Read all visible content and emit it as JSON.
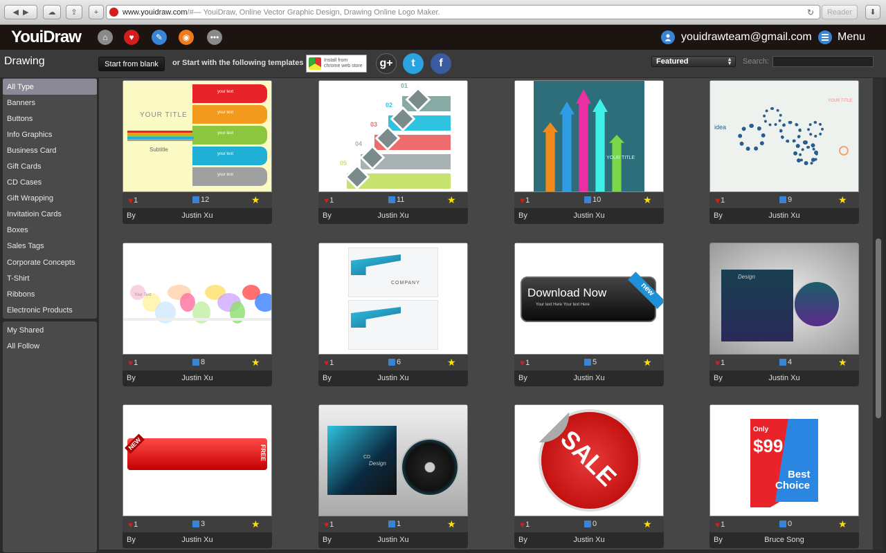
{
  "browser": {
    "url_domain": "www.youidraw.com",
    "url_rest": "/#— YouiDraw, Online Vector Graphic Design, Drawing Online Logo Maker.",
    "reader_label": "Reader"
  },
  "header": {
    "logo": "YouiDraw",
    "user_email": "youidrawteam@gmail.com",
    "menu_label": "Menu"
  },
  "toolbar": {
    "title": "Drawing",
    "start_blank": "Start from blank",
    "template_text": "or Start with the following templates",
    "chrome_store_line1": "Install from",
    "chrome_store_line2": "chrome web store",
    "social_google": "g+",
    "social_twitter": "t",
    "social_facebook": "f",
    "sort_selected": "Featured",
    "search_label": "Search:",
    "search_value": ""
  },
  "sidebar": {
    "categories": [
      "All Type",
      "Banners",
      "Buttons",
      "Info Graphics",
      "Business Card",
      "Gift Cards",
      "CD Cases",
      "Gift Wrapping",
      "Invitatioin Cards",
      "Boxes",
      "Sales Tags",
      "Corporate Concepts",
      "T-Shirt",
      "Ribbons",
      "Electronic Products"
    ],
    "active": "All Type",
    "personal": [
      "My Shared",
      "All Follow"
    ]
  },
  "cards": [
    {
      "likes": "1",
      "edits": "12",
      "by": "By",
      "author": "Justin Xu",
      "art": {
        "title": "YOUR TITLE",
        "subtitle": "Subtitle",
        "item": "your text"
      }
    },
    {
      "likes": "1",
      "edits": "11",
      "by": "By",
      "author": "Justin Xu",
      "art": {
        "steps": [
          "01",
          "02",
          "03",
          "04",
          "05"
        ]
      }
    },
    {
      "likes": "1",
      "edits": "10",
      "by": "By",
      "author": "Justin Xu",
      "art": {
        "title": "YOUR TITLE"
      }
    },
    {
      "likes": "1",
      "edits": "9",
      "by": "By",
      "author": "Justin Xu",
      "art": {
        "word": "idea",
        "title": "YOUR TITLE"
      }
    },
    {
      "likes": "1",
      "edits": "8",
      "by": "By",
      "author": "Justin Xu",
      "art": {
        "text": "Your Text"
      }
    },
    {
      "likes": "1",
      "edits": "6",
      "by": "By",
      "author": "Justin Xu",
      "art": {
        "company": "COMPANY"
      }
    },
    {
      "likes": "1",
      "edits": "5",
      "by": "By",
      "author": "Justin Xu",
      "art": {
        "button": "Download Now",
        "line": "Your text Here Your text Here",
        "badge": "new"
      }
    },
    {
      "likes": "1",
      "edits": "4",
      "by": "By",
      "author": "Justin Xu",
      "art": {
        "script": "Design"
      }
    },
    {
      "likes": "1",
      "edits": "3",
      "by": "By",
      "author": "Justin Xu",
      "art": {
        "left": "NEW",
        "right": "FREE"
      }
    },
    {
      "likes": "1",
      "edits": "1",
      "by": "By",
      "author": "Justin Xu",
      "art": {
        "cd": "CD",
        "script": "Design"
      }
    },
    {
      "likes": "1",
      "edits": "0",
      "by": "By",
      "author": "Justin Xu",
      "art": {
        "text": "SALE"
      }
    },
    {
      "likes": "1",
      "edits": "0",
      "by": "By",
      "author": "Bruce Song",
      "art": {
        "only": "Only",
        "price": "$99",
        "best": "Best",
        "choice": "Choice"
      }
    }
  ],
  "colors": {
    "header_bg": "#1c1410",
    "accent_blue": "#3a84d6",
    "heart_red": "#d41e1e",
    "star_yellow": "#ffe000"
  }
}
